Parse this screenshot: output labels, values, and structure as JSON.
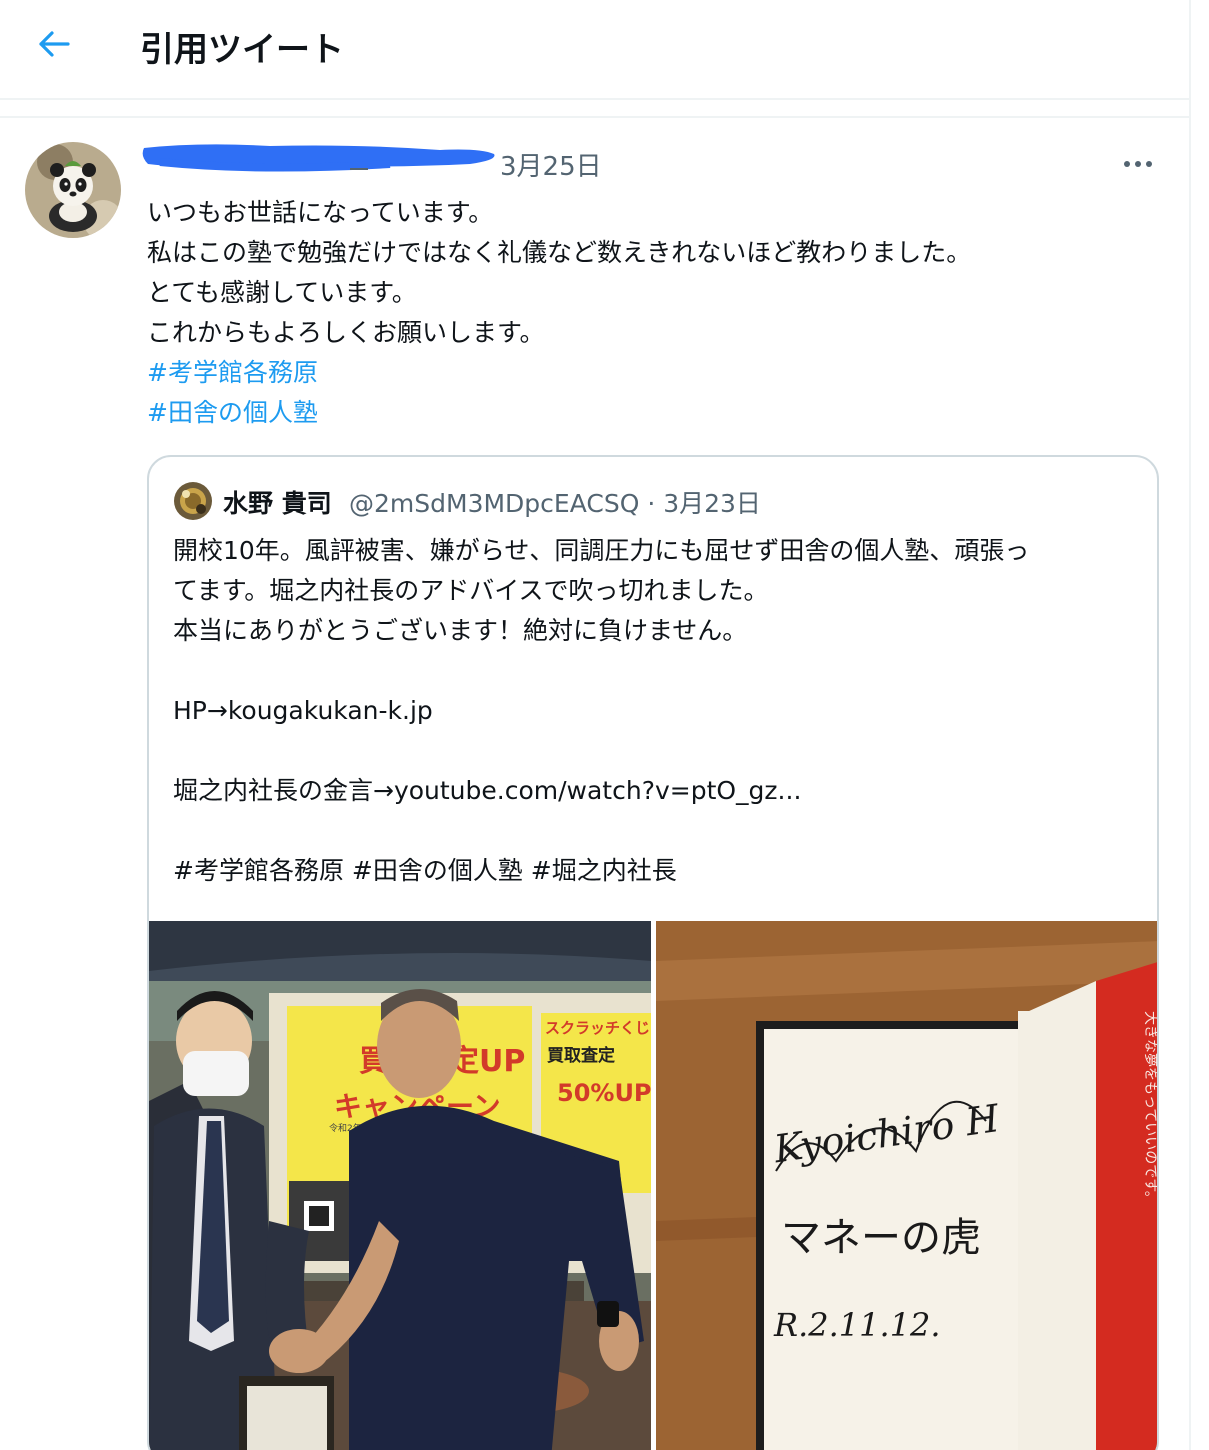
{
  "header": {
    "back_label": "←",
    "title": "引用ツイート"
  },
  "tweet": {
    "date": "3月25日",
    "lines": [
      "いつもお世話になっています。",
      "私はこの塾で勉強だけではなく礼儀など数えきれないほど教わりました。",
      "とても感謝しています。",
      "これからもよろしくお願いします。"
    ],
    "hashtags": [
      "#考学館各務原",
      "#田舎の個人塾"
    ]
  },
  "quote": {
    "name": "水野 貴司",
    "handle_date": "@2mSdM3MDpcEACSQ · 3月23日",
    "lines": [
      "開校10年。風評被害、嫌がらせ、同調圧力にも屈せず田舎の個人塾、頑張っ",
      "てます。堀之内社長のアドバイスで吹っ切れました。",
      "本当にありがとうございます！絶対に負けません。",
      "",
      "HP→kougakukan-k.jp",
      "",
      "堀之内社長の金言→youtube.com/watch?v=ptO_gz...",
      "",
      "#考学館各務原 #田舎の個人塾 #堀之内社長"
    ],
    "images": {
      "left": {
        "sign_title": "買取査定UP",
        "sign_sub": "キャンペーン",
        "sign_right_top": "スクラッチくじ",
        "sign_right_mid": "買取査定",
        "sign_right_pct": "50%UP",
        "sign_small": "令和2年10月29日"
      },
      "right": {
        "signature": "Kyoichiro H",
        "book_title": "マネーの虎",
        "date": "R.2.11.12.",
        "spine_text": "大きな夢をもっていいのです。"
      }
    }
  },
  "colors": {
    "accent": "#1d9bf0",
    "secondary_text": "#536471",
    "border": "#cfd9de"
  }
}
